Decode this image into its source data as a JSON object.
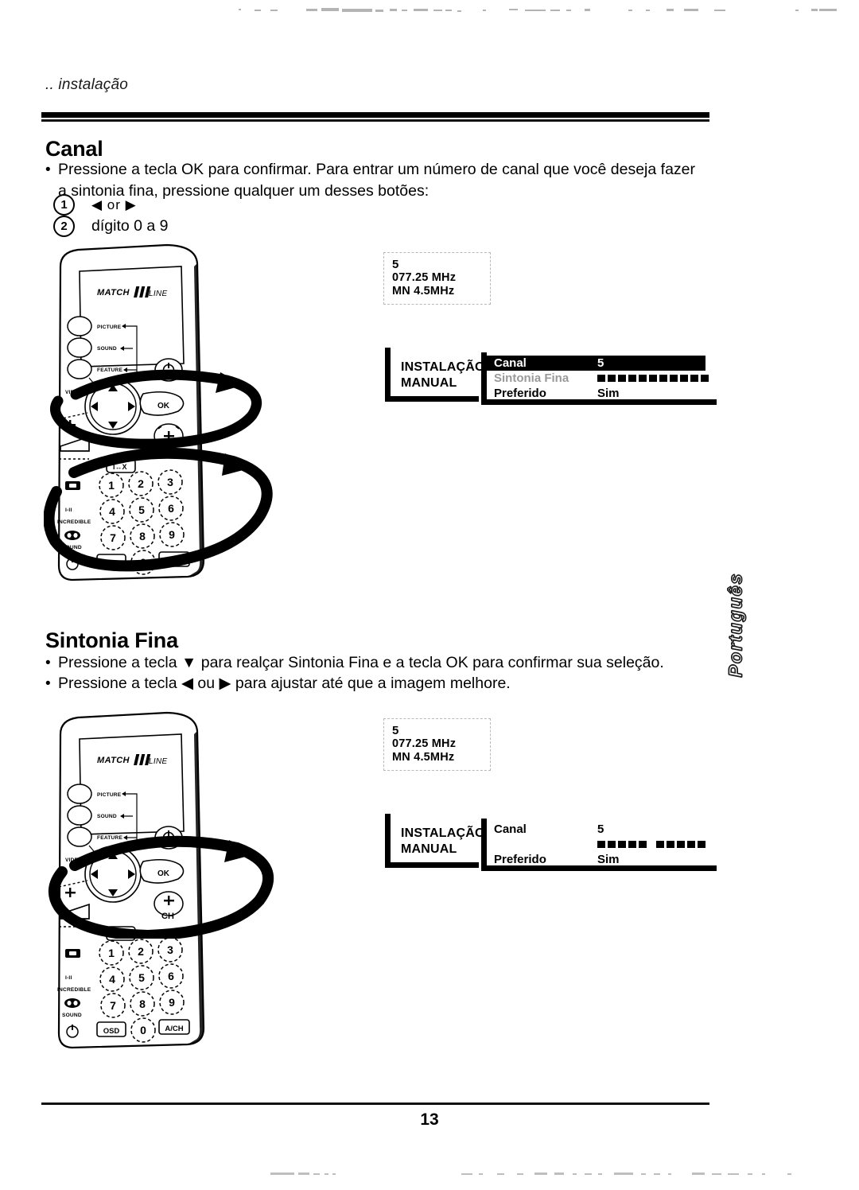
{
  "page": {
    "running_head": ".. instalação",
    "page_number": "13",
    "side_tab": "Português"
  },
  "sections": [
    {
      "id": "canal",
      "title": "Canal",
      "bullets": [
        "Pressione a tecla OK para confirmar. Para entrar um número de canal que você deseja fazer a sintonia fina, pressione qualquer um desses botões:"
      ],
      "numbered": [
        {
          "num": "1",
          "text": "◀  or  ▶"
        },
        {
          "num": "2",
          "text": "dígito 0 a 9"
        }
      ]
    },
    {
      "id": "sintonia-fina",
      "title": "Sintonia Fina",
      "bullets": [
        "Pressione a tecla ▼ para realçar Sintonia Fina e a tecla OK para confirmar sua seleção.",
        "Pressione a tecla ◀ ou ▶ para ajustar até que a imagem melhore."
      ]
    }
  ],
  "osd_displays": [
    {
      "id": "osd-1",
      "frequency_box": {
        "channel": "5",
        "frequency": "077.25  MHz",
        "system": "MN  4.5MHz"
      },
      "menu_title": "INSTALAÇÃO MANUAL",
      "menu_title_line1": "INSTALAÇÃO",
      "menu_title_line2": "MANUAL",
      "rows": [
        {
          "label": "Canal",
          "value": "5",
          "state": "highlight"
        },
        {
          "label": "Sintonia Fina",
          "value": "",
          "state": "bar",
          "bar_segments": 11
        },
        {
          "label": "Preferido",
          "value": "Sim",
          "state": "normal"
        }
      ]
    },
    {
      "id": "osd-2",
      "frequency_box": {
        "channel": "5",
        "frequency": "077.25  MHz",
        "system": "MN  4.5MHz"
      },
      "menu_title": "INSTALAÇÃO MANUAL",
      "menu_title_line1": "INSTALAÇÃO",
      "menu_title_line2": "MANUAL",
      "rows": [
        {
          "label": "Canal",
          "value": "5",
          "state": "normal"
        },
        {
          "label": "",
          "value": "",
          "state": "bar",
          "bar_segments": 10
        },
        {
          "label": "Preferido",
          "value": "Sim",
          "state": "normal"
        }
      ]
    }
  ],
  "remote": {
    "brand": "MATCH LINE",
    "brand_part1": "MATCH",
    "brand_part2": "LINE",
    "side_buttons": [
      "PICTURE",
      "SOUND",
      "FEATURE"
    ],
    "video_label": "VIDEO",
    "ok_label": "OK",
    "power_label": "power-icon",
    "channel_label": "CH",
    "left_labels": [
      "I-II",
      "INCREDIBLE",
      "SOUND"
    ],
    "keypad": [
      "1",
      "2",
      "3",
      "4",
      "5",
      "6",
      "7",
      "8",
      "9"
    ],
    "bottom_keys": [
      "OSD",
      "0",
      "A/CH"
    ]
  }
}
